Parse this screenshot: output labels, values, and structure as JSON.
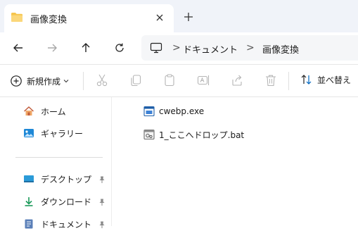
{
  "tab": {
    "title": "画像変換",
    "icon": "folder-icon",
    "close_icon": "close-icon",
    "new_tab_icon": "plus-icon"
  },
  "nav": {
    "back_icon": "arrow-left-icon",
    "forward_icon": "arrow-right-icon",
    "up_icon": "arrow-up-icon",
    "refresh_icon": "refresh-icon"
  },
  "address": {
    "root_icon": "computer-icon",
    "separator": ">",
    "crumbs": [
      "ドキュメント",
      "画像変換"
    ]
  },
  "toolbar": {
    "new_label": "新規作成",
    "sort_label": "並べ替え",
    "icons": [
      "cut-icon",
      "copy-icon",
      "paste-icon",
      "rename-icon",
      "share-icon",
      "delete-icon"
    ]
  },
  "sidebar": {
    "items": [
      {
        "label": "ホーム",
        "icon": "home-icon"
      },
      {
        "label": "ギャラリー",
        "icon": "gallery-icon"
      },
      {
        "label": "デスクトップ",
        "icon": "desktop-icon",
        "pinned": true
      },
      {
        "label": "ダウンロード",
        "icon": "download-icon",
        "pinned": true
      },
      {
        "label": "ドキュメント",
        "icon": "document-icon",
        "pinned": true
      }
    ]
  },
  "files": [
    {
      "name": "cwebp.exe",
      "icon": "exe-file-icon"
    },
    {
      "name": "1_ここへドロップ.bat",
      "icon": "bat-file-icon"
    }
  ],
  "colors": {
    "accent": "#0067c0",
    "folder": "#f6c54d",
    "tab_strip": "#f0f3f9",
    "address_bg": "#f5f6f8"
  }
}
